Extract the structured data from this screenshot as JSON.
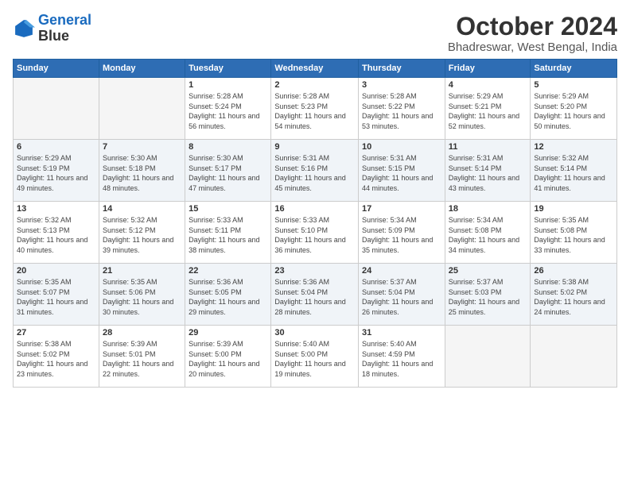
{
  "logo": {
    "line1": "General",
    "line2": "Blue"
  },
  "title": "October 2024",
  "subtitle": "Bhadreswar, West Bengal, India",
  "days_of_week": [
    "Sunday",
    "Monday",
    "Tuesday",
    "Wednesday",
    "Thursday",
    "Friday",
    "Saturday"
  ],
  "weeks": [
    [
      {
        "day": "",
        "empty": true
      },
      {
        "day": "",
        "empty": true
      },
      {
        "day": "1",
        "sunrise": "Sunrise: 5:28 AM",
        "sunset": "Sunset: 5:24 PM",
        "daylight": "Daylight: 11 hours and 56 minutes."
      },
      {
        "day": "2",
        "sunrise": "Sunrise: 5:28 AM",
        "sunset": "Sunset: 5:23 PM",
        "daylight": "Daylight: 11 hours and 54 minutes."
      },
      {
        "day": "3",
        "sunrise": "Sunrise: 5:28 AM",
        "sunset": "Sunset: 5:22 PM",
        "daylight": "Daylight: 11 hours and 53 minutes."
      },
      {
        "day": "4",
        "sunrise": "Sunrise: 5:29 AM",
        "sunset": "Sunset: 5:21 PM",
        "daylight": "Daylight: 11 hours and 52 minutes."
      },
      {
        "day": "5",
        "sunrise": "Sunrise: 5:29 AM",
        "sunset": "Sunset: 5:20 PM",
        "daylight": "Daylight: 11 hours and 50 minutes."
      }
    ],
    [
      {
        "day": "6",
        "sunrise": "Sunrise: 5:29 AM",
        "sunset": "Sunset: 5:19 PM",
        "daylight": "Daylight: 11 hours and 49 minutes."
      },
      {
        "day": "7",
        "sunrise": "Sunrise: 5:30 AM",
        "sunset": "Sunset: 5:18 PM",
        "daylight": "Daylight: 11 hours and 48 minutes."
      },
      {
        "day": "8",
        "sunrise": "Sunrise: 5:30 AM",
        "sunset": "Sunset: 5:17 PM",
        "daylight": "Daylight: 11 hours and 47 minutes."
      },
      {
        "day": "9",
        "sunrise": "Sunrise: 5:31 AM",
        "sunset": "Sunset: 5:16 PM",
        "daylight": "Daylight: 11 hours and 45 minutes."
      },
      {
        "day": "10",
        "sunrise": "Sunrise: 5:31 AM",
        "sunset": "Sunset: 5:15 PM",
        "daylight": "Daylight: 11 hours and 44 minutes."
      },
      {
        "day": "11",
        "sunrise": "Sunrise: 5:31 AM",
        "sunset": "Sunset: 5:14 PM",
        "daylight": "Daylight: 11 hours and 43 minutes."
      },
      {
        "day": "12",
        "sunrise": "Sunrise: 5:32 AM",
        "sunset": "Sunset: 5:14 PM",
        "daylight": "Daylight: 11 hours and 41 minutes."
      }
    ],
    [
      {
        "day": "13",
        "sunrise": "Sunrise: 5:32 AM",
        "sunset": "Sunset: 5:13 PM",
        "daylight": "Daylight: 11 hours and 40 minutes."
      },
      {
        "day": "14",
        "sunrise": "Sunrise: 5:32 AM",
        "sunset": "Sunset: 5:12 PM",
        "daylight": "Daylight: 11 hours and 39 minutes."
      },
      {
        "day": "15",
        "sunrise": "Sunrise: 5:33 AM",
        "sunset": "Sunset: 5:11 PM",
        "daylight": "Daylight: 11 hours and 38 minutes."
      },
      {
        "day": "16",
        "sunrise": "Sunrise: 5:33 AM",
        "sunset": "Sunset: 5:10 PM",
        "daylight": "Daylight: 11 hours and 36 minutes."
      },
      {
        "day": "17",
        "sunrise": "Sunrise: 5:34 AM",
        "sunset": "Sunset: 5:09 PM",
        "daylight": "Daylight: 11 hours and 35 minutes."
      },
      {
        "day": "18",
        "sunrise": "Sunrise: 5:34 AM",
        "sunset": "Sunset: 5:08 PM",
        "daylight": "Daylight: 11 hours and 34 minutes."
      },
      {
        "day": "19",
        "sunrise": "Sunrise: 5:35 AM",
        "sunset": "Sunset: 5:08 PM",
        "daylight": "Daylight: 11 hours and 33 minutes."
      }
    ],
    [
      {
        "day": "20",
        "sunrise": "Sunrise: 5:35 AM",
        "sunset": "Sunset: 5:07 PM",
        "daylight": "Daylight: 11 hours and 31 minutes."
      },
      {
        "day": "21",
        "sunrise": "Sunrise: 5:35 AM",
        "sunset": "Sunset: 5:06 PM",
        "daylight": "Daylight: 11 hours and 30 minutes."
      },
      {
        "day": "22",
        "sunrise": "Sunrise: 5:36 AM",
        "sunset": "Sunset: 5:05 PM",
        "daylight": "Daylight: 11 hours and 29 minutes."
      },
      {
        "day": "23",
        "sunrise": "Sunrise: 5:36 AM",
        "sunset": "Sunset: 5:04 PM",
        "daylight": "Daylight: 11 hours and 28 minutes."
      },
      {
        "day": "24",
        "sunrise": "Sunrise: 5:37 AM",
        "sunset": "Sunset: 5:04 PM",
        "daylight": "Daylight: 11 hours and 26 minutes."
      },
      {
        "day": "25",
        "sunrise": "Sunrise: 5:37 AM",
        "sunset": "Sunset: 5:03 PM",
        "daylight": "Daylight: 11 hours and 25 minutes."
      },
      {
        "day": "26",
        "sunrise": "Sunrise: 5:38 AM",
        "sunset": "Sunset: 5:02 PM",
        "daylight": "Daylight: 11 hours and 24 minutes."
      }
    ],
    [
      {
        "day": "27",
        "sunrise": "Sunrise: 5:38 AM",
        "sunset": "Sunset: 5:02 PM",
        "daylight": "Daylight: 11 hours and 23 minutes."
      },
      {
        "day": "28",
        "sunrise": "Sunrise: 5:39 AM",
        "sunset": "Sunset: 5:01 PM",
        "daylight": "Daylight: 11 hours and 22 minutes."
      },
      {
        "day": "29",
        "sunrise": "Sunrise: 5:39 AM",
        "sunset": "Sunset: 5:00 PM",
        "daylight": "Daylight: 11 hours and 20 minutes."
      },
      {
        "day": "30",
        "sunrise": "Sunrise: 5:40 AM",
        "sunset": "Sunset: 5:00 PM",
        "daylight": "Daylight: 11 hours and 19 minutes."
      },
      {
        "day": "31",
        "sunrise": "Sunrise: 5:40 AM",
        "sunset": "Sunset: 4:59 PM",
        "daylight": "Daylight: 11 hours and 18 minutes."
      },
      {
        "day": "",
        "empty": true
      },
      {
        "day": "",
        "empty": true
      }
    ]
  ]
}
